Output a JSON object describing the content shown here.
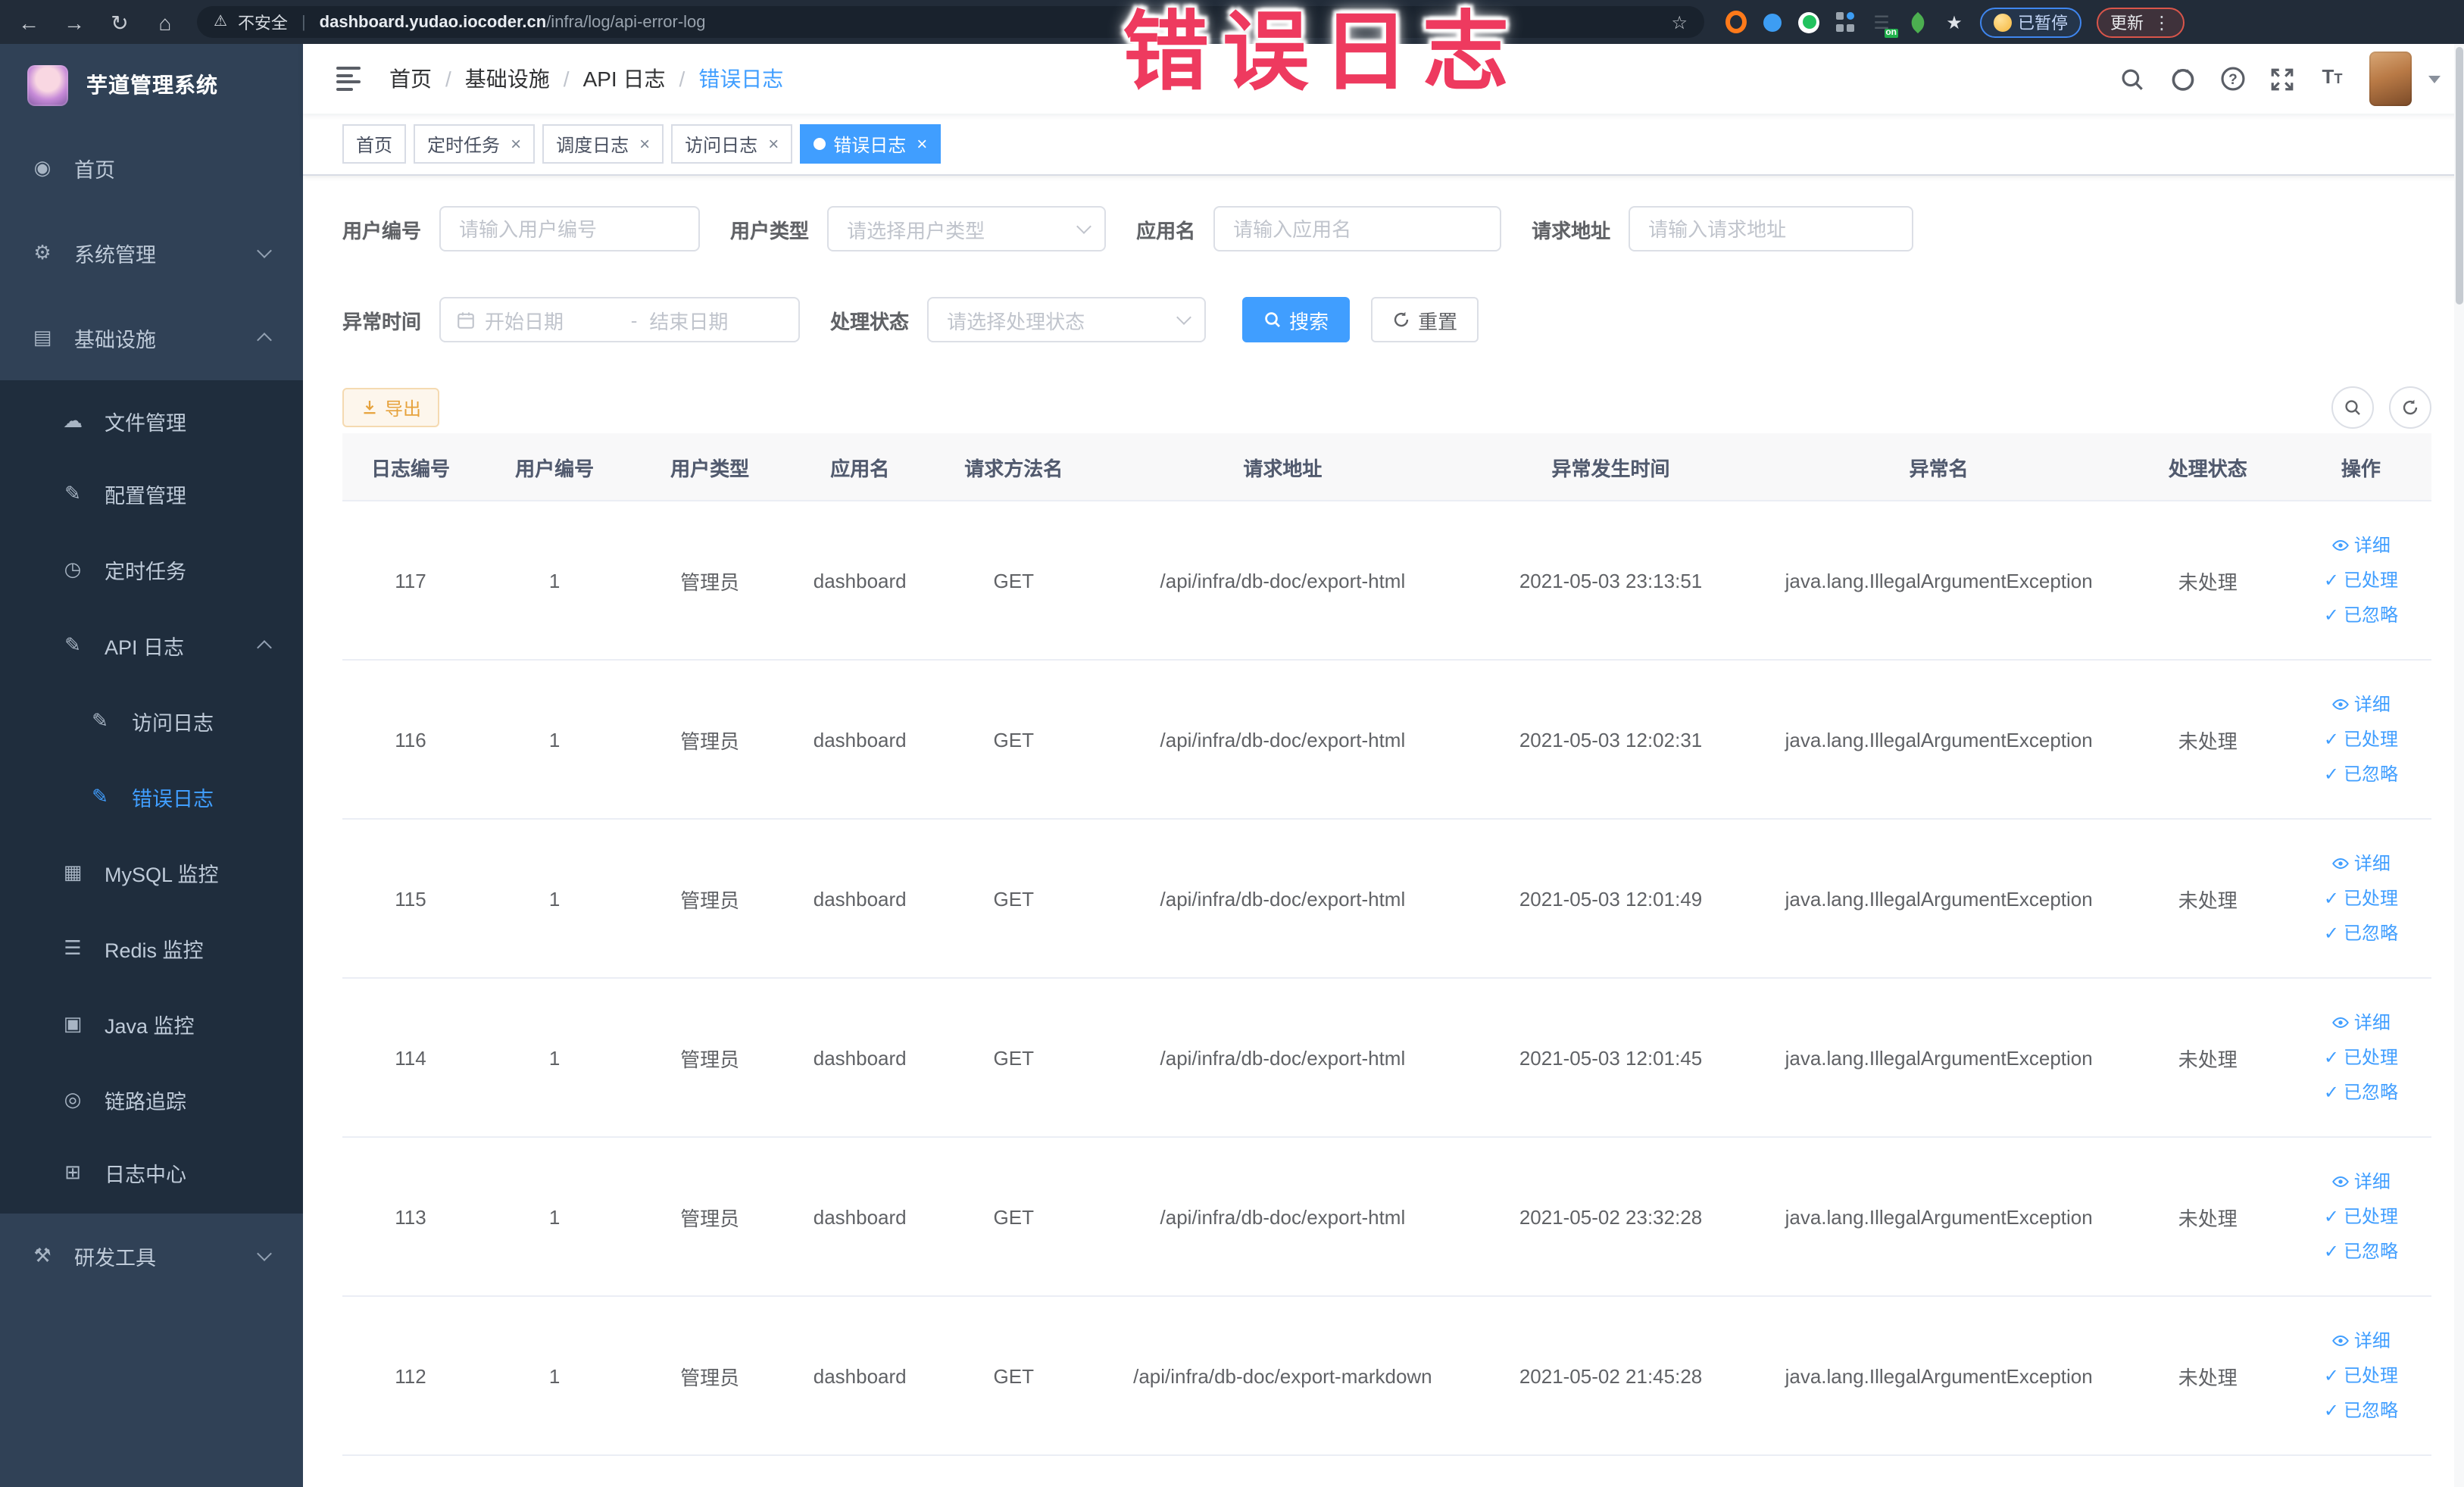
{
  "browser": {
    "security_label": "不安全",
    "url_domain": "dashboard.yudao.iocoder.cn",
    "url_path": "/infra/log/api-error-log",
    "paused_button": "已暂停",
    "update_button": "更新",
    "icons": [
      "back-icon",
      "forward-icon",
      "reload-icon",
      "home-icon",
      "warning-icon",
      "bookmark-star-icon",
      "adblock-icon",
      "shield-icon",
      "green-extension-icon",
      "grid-extension-icon",
      "switch-on-extension-icon",
      "leaf-extension-icon",
      "puzzle-extension-icon",
      "kebab-menu-icon"
    ]
  },
  "annotation": {
    "text": "错误日志",
    "color": "#ee3a5f"
  },
  "sidebar": {
    "app_title": "芋道管理系统",
    "items": [
      {
        "key": "home",
        "label": "首页",
        "level": 1,
        "icon": "dashboard-icon",
        "glyph": "◉"
      },
      {
        "key": "system",
        "label": "系统管理",
        "level": 1,
        "icon": "gear-icon",
        "glyph": "⚙",
        "chevron": "down"
      },
      {
        "key": "infra",
        "label": "基础设施",
        "level": 1,
        "icon": "infrastructure-icon",
        "glyph": "▤",
        "chevron": "up"
      },
      {
        "key": "file-manage",
        "label": "文件管理",
        "level": 2,
        "dark": true,
        "icon": "cloud-upload-icon",
        "glyph": "☁"
      },
      {
        "key": "config-manage",
        "label": "配置管理",
        "level": 2,
        "dark": true,
        "icon": "edit-icon",
        "glyph": "✎"
      },
      {
        "key": "scheduled-job",
        "label": "定时任务",
        "level": 2,
        "dark": true,
        "icon": "clock-icon",
        "glyph": "◷"
      },
      {
        "key": "api-log",
        "label": "API 日志",
        "level": 2,
        "dark": true,
        "icon": "log-edit-icon",
        "glyph": "✎",
        "chevron": "up"
      },
      {
        "key": "access-log",
        "label": "访问日志",
        "level": 3,
        "dark": true,
        "icon": "log-edit-icon",
        "glyph": "✎"
      },
      {
        "key": "error-log",
        "label": "错误日志",
        "level": 3,
        "dark": true,
        "icon": "log-edit-icon",
        "glyph": "✎",
        "active": true
      },
      {
        "key": "mysql-monitor",
        "label": "MySQL 监控",
        "level": 2,
        "dark": true,
        "icon": "mysql-monitor-icon",
        "glyph": "▦"
      },
      {
        "key": "redis-monitor",
        "label": "Redis 监控",
        "level": 2,
        "dark": true,
        "icon": "redis-monitor-icon",
        "glyph": "☰"
      },
      {
        "key": "java-monitor",
        "label": "Java 监控",
        "level": 2,
        "dark": true,
        "icon": "java-monitor-icon",
        "glyph": "▣"
      },
      {
        "key": "trace",
        "label": "链路追踪",
        "level": 2,
        "dark": true,
        "icon": "trace-eye-icon",
        "glyph": "◎"
      },
      {
        "key": "log-center",
        "label": "日志中心",
        "level": 2,
        "dark": true,
        "icon": "log-center-icon",
        "glyph": "⊞"
      },
      {
        "key": "dev-tools",
        "label": "研发工具",
        "level": 1,
        "icon": "tools-icon",
        "glyph": "⚒",
        "chevron": "down"
      }
    ]
  },
  "header": {
    "breadcrumb": [
      "首页",
      "基础设施",
      "API 日志",
      "错误日志"
    ],
    "separator": "/"
  },
  "tabs": [
    {
      "label": "首页",
      "closable": false,
      "active": false
    },
    {
      "label": "定时任务",
      "closable": true,
      "active": false
    },
    {
      "label": "调度日志",
      "closable": true,
      "active": false
    },
    {
      "label": "访问日志",
      "closable": true,
      "active": false
    },
    {
      "label": "错误日志",
      "closable": true,
      "active": true
    }
  ],
  "filters": {
    "user_id": {
      "label": "用户编号",
      "placeholder": "请输入用户编号"
    },
    "user_type": {
      "label": "用户类型",
      "placeholder": "请选择用户类型"
    },
    "app_name": {
      "label": "应用名",
      "placeholder": "请输入应用名"
    },
    "request_url": {
      "label": "请求地址",
      "placeholder": "请输入请求地址"
    },
    "exception_time": {
      "label": "异常时间",
      "start_placeholder": "开始日期",
      "separator": "-",
      "end_placeholder": "结束日期"
    },
    "process_status": {
      "label": "处理状态",
      "placeholder": "请选择处理状态"
    },
    "search_label": "搜索",
    "reset_label": "重置"
  },
  "toolbar": {
    "export_label": "导出"
  },
  "table": {
    "columns": [
      "日志编号",
      "用户编号",
      "用户类型",
      "应用名",
      "请求方法名",
      "请求地址",
      "异常发生时间",
      "异常名",
      "处理状态",
      "操作"
    ],
    "actions": [
      {
        "key": "detail",
        "label": "详细",
        "icon": "eye-icon"
      },
      {
        "key": "processed",
        "label": "已处理",
        "icon": "check-icon"
      },
      {
        "key": "ignored",
        "label": "已忽略",
        "icon": "check-icon"
      }
    ],
    "rows": [
      {
        "id": "117",
        "user_id": "1",
        "user_type": "管理员",
        "app_name": "dashboard",
        "method": "GET",
        "url": "/api/infra/db-doc/export-html",
        "time": "2021-05-03 23:13:51",
        "exception": "java.lang.IllegalArgumentException",
        "status": "未处理"
      },
      {
        "id": "116",
        "user_id": "1",
        "user_type": "管理员",
        "app_name": "dashboard",
        "method": "GET",
        "url": "/api/infra/db-doc/export-html",
        "time": "2021-05-03 12:02:31",
        "exception": "java.lang.IllegalArgumentException",
        "status": "未处理"
      },
      {
        "id": "115",
        "user_id": "1",
        "user_type": "管理员",
        "app_name": "dashboard",
        "method": "GET",
        "url": "/api/infra/db-doc/export-html",
        "time": "2021-05-03 12:01:49",
        "exception": "java.lang.IllegalArgumentException",
        "status": "未处理"
      },
      {
        "id": "114",
        "user_id": "1",
        "user_type": "管理员",
        "app_name": "dashboard",
        "method": "GET",
        "url": "/api/infra/db-doc/export-html",
        "time": "2021-05-03 12:01:45",
        "exception": "java.lang.IllegalArgumentException",
        "status": "未处理"
      },
      {
        "id": "113",
        "user_id": "1",
        "user_type": "管理员",
        "app_name": "dashboard",
        "method": "GET",
        "url": "/api/infra/db-doc/export-html",
        "time": "2021-05-02 23:32:28",
        "exception": "java.lang.IllegalArgumentException",
        "status": "未处理"
      },
      {
        "id": "112",
        "user_id": "1",
        "user_type": "管理员",
        "app_name": "dashboard",
        "method": "GET",
        "url": "/api/infra/db-doc/export-markdown",
        "time": "2021-05-02 21:45:28",
        "exception": "java.lang.IllegalArgumentException",
        "status": "未处理"
      }
    ]
  }
}
